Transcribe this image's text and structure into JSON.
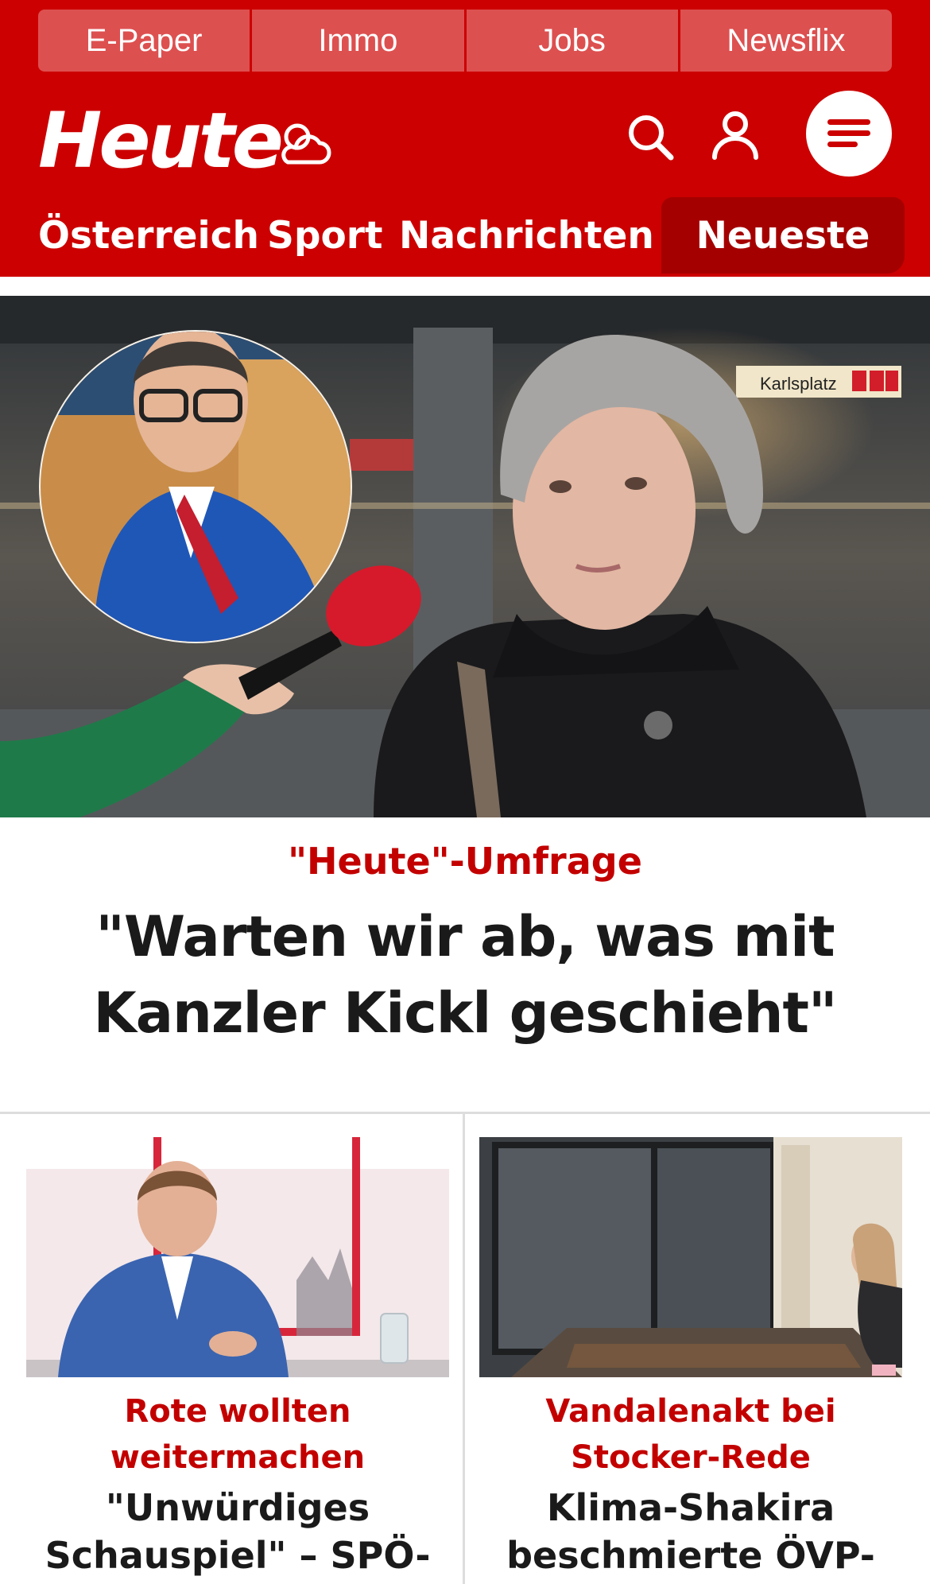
{
  "topnav": {
    "items": [
      "E-Paper",
      "Immo",
      "Jobs",
      "Newsflix"
    ]
  },
  "brand": {
    "logo_text": "Heute"
  },
  "mainnav": {
    "items": [
      "Österreich",
      "Sport",
      "Nachrichten"
    ],
    "active_label": "Neueste"
  },
  "hero": {
    "kicker": "\"Heute\"-Umfrage",
    "headline": "\"Warten wir ab, was mit Kanzler Kickl geschieht\"",
    "image_sign": "Karlsplatz"
  },
  "cards": [
    {
      "kicker": "Rote wollten weitermachen",
      "title": "\"Unwürdiges Schauspiel\" – SPÖ-"
    },
    {
      "kicker": "Vandalenakt bei Stocker-Rede",
      "title": "Klima-Shakira beschmierte ÖVP-"
    }
  ],
  "colors": {
    "brand_red": "#cc0000",
    "active_tab": "#a50000",
    "kicker_red": "#c30000",
    "text_dark": "#1a1a1a"
  },
  "icons": [
    "weather-cloud-sun-icon",
    "search-icon",
    "user-icon",
    "menu-icon"
  ]
}
